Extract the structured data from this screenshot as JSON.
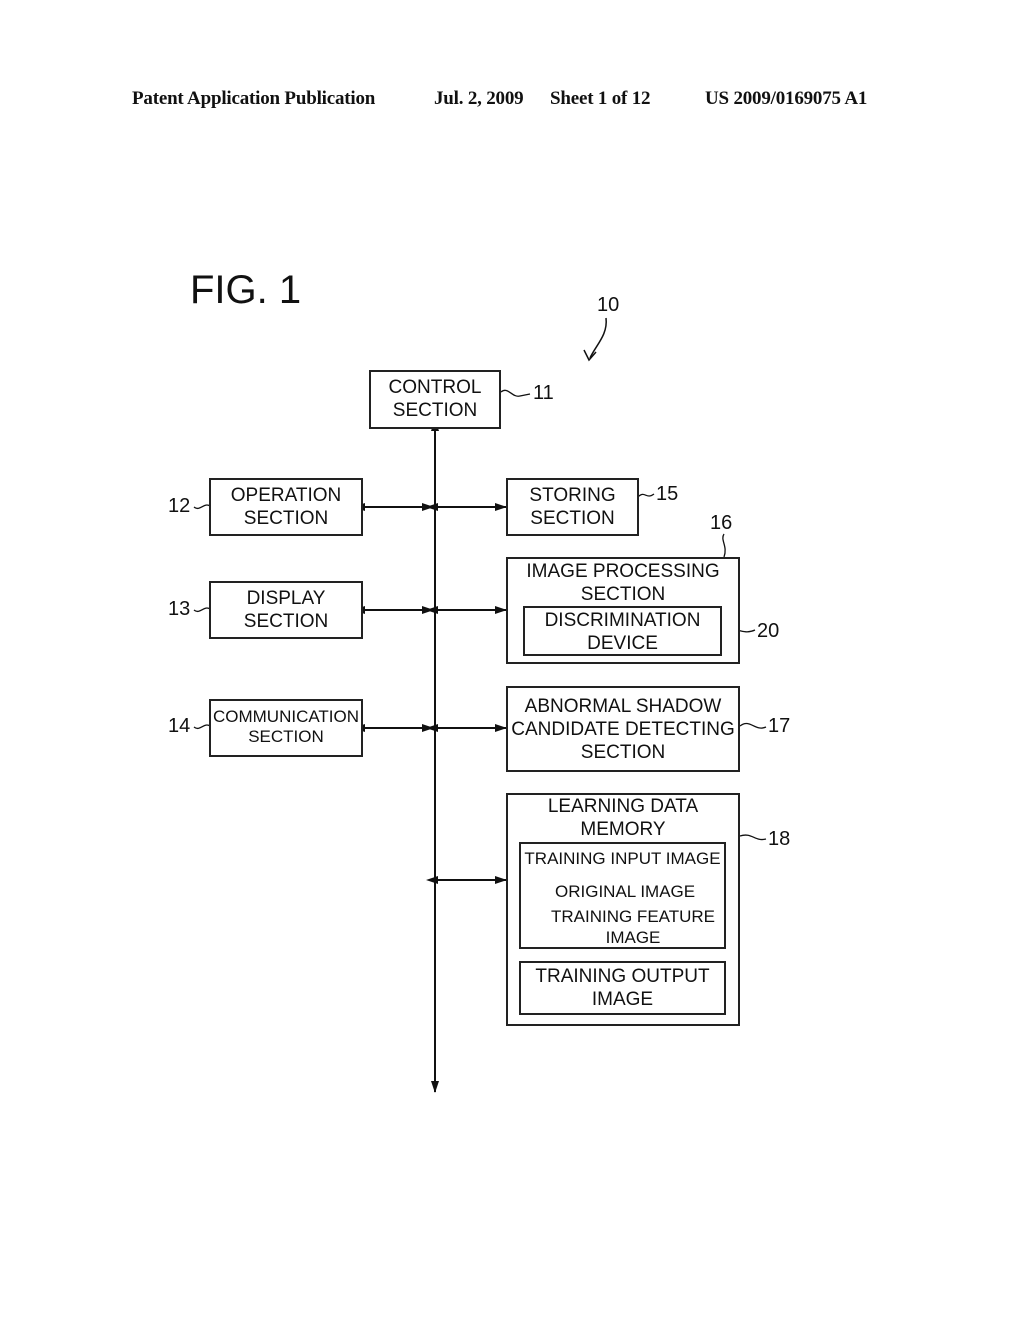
{
  "header": {
    "publication": "Patent Application Publication",
    "date": "Jul. 2, 2009",
    "sheet": "Sheet 1 of 12",
    "number": "US 2009/0169075 A1"
  },
  "figure": {
    "title": "FIG. 1",
    "system_ref": "10",
    "blocks": {
      "control": {
        "line1": "CONTROL",
        "line2": "SECTION",
        "ref": "11"
      },
      "operation": {
        "line1": "OPERATION",
        "line2": "SECTION",
        "ref": "12"
      },
      "display": {
        "line1": "DISPLAY",
        "line2": "SECTION",
        "ref": "13"
      },
      "communication": {
        "line1": "COMMUNICATION",
        "line2": "SECTION",
        "ref": "14"
      },
      "storing": {
        "line1": "STORING",
        "line2": "SECTION",
        "ref": "15"
      },
      "image_processing": {
        "line1": "IMAGE PROCESSING",
        "line2": "SECTION",
        "ref": "16"
      },
      "discrimination": {
        "line1": "DISCRIMINATION",
        "line2": "DEVICE",
        "ref": "20"
      },
      "abnormal": {
        "line1": "ABNORMAL SHADOW",
        "line2": "CANDIDATE DETECTING",
        "line3": "SECTION",
        "ref": "17"
      },
      "learning": {
        "line1": "LEARNING DATA",
        "line2": "MEMORY",
        "ref": "18",
        "training_input": "TRAINING INPUT IMAGE",
        "original_image": "ORIGINAL IMAGE",
        "training_feature_1": "TRAINING FEATURE",
        "training_feature_2": "IMAGE",
        "training_output_1": "TRAINING OUTPUT",
        "training_output_2": "IMAGE"
      }
    }
  }
}
